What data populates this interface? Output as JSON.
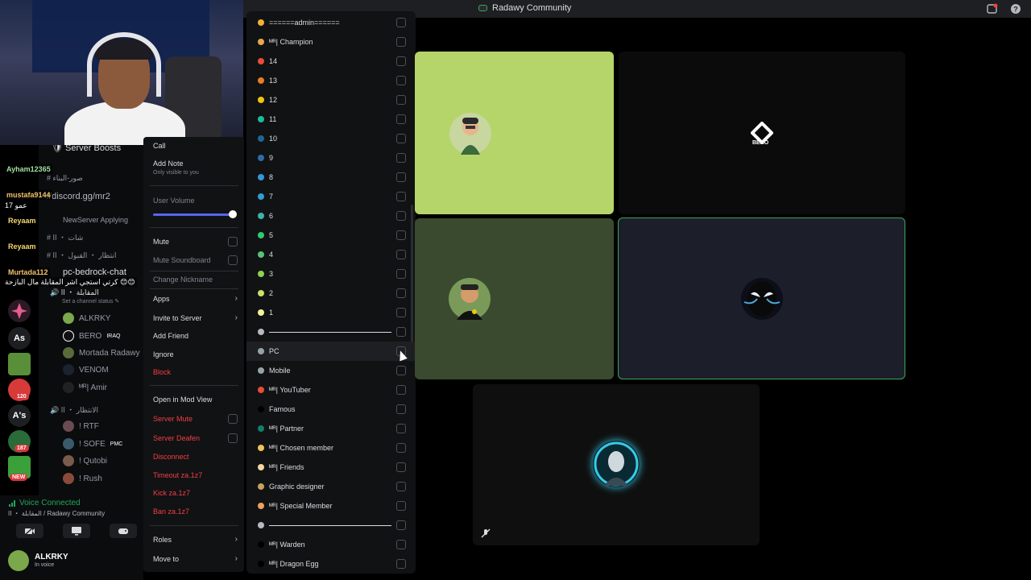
{
  "window": {
    "title": "Radawy Community"
  },
  "sidebar": {
    "channels": [
      {
        "name": "Server Boosts"
      },
      {
        "name": "صور-البناء"
      },
      {
        "name": "//discord.gg/mr2"
      },
      {
        "name": "NewServer Applying"
      },
      {
        "name": "شات ・ اا"
      },
      {
        "name": "انتظار ・ القبول ・ اا"
      },
      {
        "name": "pc-bedrock-chat"
      },
      {
        "name": "المقابلة ・ اا"
      },
      {
        "name": "Set a channel status"
      },
      {
        "name": "الانتظار ・ اا"
      }
    ],
    "voice_members_1": [
      {
        "name": "ALKRKY",
        "tag": ""
      },
      {
        "name": "BERO",
        "tag": "IRAQ"
      },
      {
        "name": "Mortada Radawy",
        "tag": ""
      },
      {
        "name": "VENOM",
        "tag": ""
      },
      {
        "name": "ᴹᴿ| Amir",
        "tag": ""
      }
    ],
    "voice_members_2": [
      {
        "name": "! RTF",
        "tag": ""
      },
      {
        "name": "! SOFE",
        "tag": "PMC"
      },
      {
        "name": "! Qutobi",
        "tag": ""
      },
      {
        "name": "! Rush",
        "tag": ""
      }
    ]
  },
  "rail": {
    "servers": [
      "As",
      "A's"
    ],
    "badges": [
      "120",
      "187",
      "NEW"
    ]
  },
  "chat_overlay": [
    {
      "name": "Ayham12365",
      "msg": ""
    },
    {
      "name": "mustafa9144",
      "msg": "عمو 17"
    },
    {
      "name": "Reyaam",
      "msg": ""
    },
    {
      "name": "Reyaam",
      "msg": ""
    },
    {
      "name": "Murtada112",
      "msg": "كرتي استجي اشر المقابلة مال البازحة 😊😊"
    }
  ],
  "context_menu": {
    "call": "Call",
    "add_note": "Add Note",
    "note_hint": "Only visible to you",
    "user_volume": "User Volume",
    "mute": "Mute",
    "mute_soundboard": "Mute Soundboard",
    "change_nickname": "Change Nickname",
    "apps": "Apps",
    "invite": "Invite to Server",
    "add_friend": "Add Friend",
    "ignore": "Ignore",
    "block": "Block",
    "mod_view": "Open in Mod View",
    "server_mute": "Server Mute",
    "server_deafen": "Server Deafen",
    "disconnect": "Disconnect",
    "timeout": "Timeout za.1z7",
    "kick": "Kick za.1z7",
    "ban": "Ban za.1z7",
    "roles": "Roles",
    "move_to": "Move to",
    "user_volume_level": 1.0
  },
  "roles": [
    {
      "label": "======admin======",
      "color": "#f0b232"
    },
    {
      "label": "ᴹᴿ| Champion",
      "color": "#e5a84f"
    },
    {
      "label": "14",
      "color": "#e74c3c"
    },
    {
      "label": "13",
      "color": "#e67e22"
    },
    {
      "label": "12",
      "color": "#f1c40f"
    },
    {
      "label": "11",
      "color": "#1abc9c"
    },
    {
      "label": "10",
      "color": "#206694"
    },
    {
      "label": "9",
      "color": "#2e6da4"
    },
    {
      "label": "8",
      "color": "#3498db"
    },
    {
      "label": "7",
      "color": "#2f9fd0"
    },
    {
      "label": "6",
      "color": "#3bb3a8"
    },
    {
      "label": "5",
      "color": "#2ecc71"
    },
    {
      "label": "4",
      "color": "#57c27a"
    },
    {
      "label": "3",
      "color": "#8fd14f"
    },
    {
      "label": "2",
      "color": "#c7e06b"
    },
    {
      "label": "1",
      "color": "#f4f39c"
    },
    {
      "label": "",
      "color": "#b5bac1",
      "separator": true
    },
    {
      "label": "PC",
      "color": "#95a5a6",
      "highlight": true
    },
    {
      "label": "Mobile",
      "color": "#95a5a6"
    },
    {
      "label": "ᴹᴿ| YouTuber",
      "color": "#e74c3c"
    },
    {
      "label": "Famous",
      "color": "#000000"
    },
    {
      "label": "ᴹᴿ| Partner",
      "color": "#11806a"
    },
    {
      "label": "ᴹᴿ| Chosen member",
      "color": "#f0c35a"
    },
    {
      "label": "ᴹᴿ| Friends",
      "color": "#f5d7a1"
    },
    {
      "label": "Graphic designer",
      "color": "#c9a15e"
    },
    {
      "label": "ᴹᴿ| Special Member",
      "color": "#f0a05a"
    },
    {
      "label": "",
      "color": "#b5bac1",
      "separator": true
    },
    {
      "label": "ᴹᴿ| Warden",
      "color": "#000000"
    },
    {
      "label": "ᴹᴿ| Dragon Egg",
      "color": "#000000"
    }
  ],
  "video": {
    "tiles": [
      {
        "name": "green-tile",
        "bg": "#b5d56a"
      },
      {
        "name": "bero-tile",
        "label": "BERO",
        "bg": "#0b0b0b"
      },
      {
        "name": "olive-tile",
        "bg": "#3a4a2e"
      },
      {
        "name": "venom-tile",
        "bg": "#1c1f2a"
      },
      {
        "name": "lower-tile",
        "bg": "#0f0f0f"
      }
    ]
  },
  "voice_panel": {
    "status": "Voice Connected",
    "location": "المقابلة ・ اا / Radawy Community"
  },
  "user": {
    "name": "ALKRKY",
    "status": "In voice"
  },
  "colors": {
    "accent": "#5865f2",
    "danger": "#f23f43",
    "connected": "#23a55a"
  }
}
